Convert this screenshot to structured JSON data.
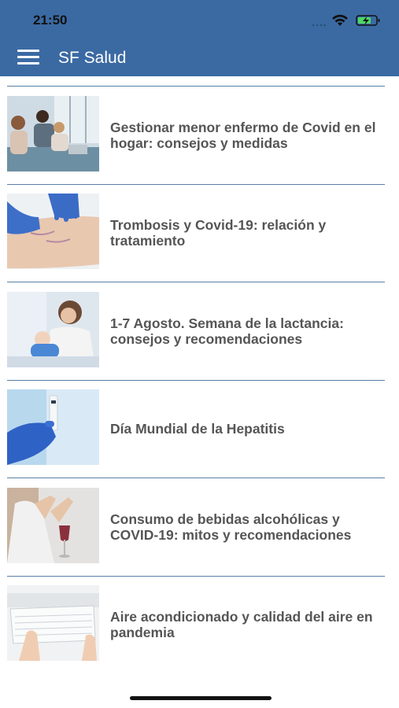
{
  "status_bar": {
    "time": "21:50"
  },
  "header": {
    "title": "SF Salud",
    "menu_icon": "hamburger-menu-icon",
    "background_color": "#3b6aa3"
  },
  "articles": [
    {
      "title": "Gestionar menor enfermo de Covid en el hogar: consejos y medidas",
      "image": "family-with-sick-child-photo"
    },
    {
      "title": "Trombosis y Covid-19: relación y tratamiento",
      "image": "gloved-hands-on-leg-photo"
    },
    {
      "title": "1-7 Agosto. Semana de la lactancia: consejos y recomendaciones",
      "image": "mother-breastfeeding-photo"
    },
    {
      "title": "Día Mundial de la Hepatitis",
      "image": "gloved-hand-test-tube-photo"
    },
    {
      "title": "Consumo de bebidas alcohólicas y COVID-19: mitos y recomendaciones",
      "image": "woman-refusing-wine-photo"
    },
    {
      "title": "Aire acondicionado y calidad del aire en pandemia",
      "image": "hand-on-air-conditioner-photo"
    }
  ]
}
